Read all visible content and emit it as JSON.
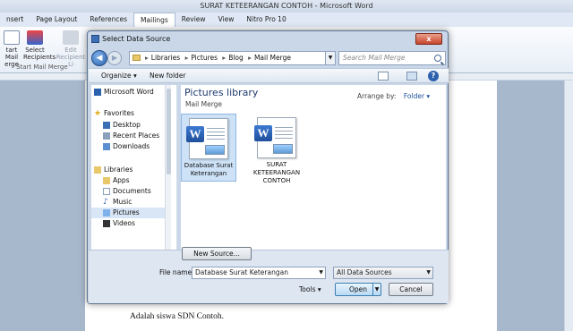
{
  "word": {
    "title": "SURAT KETEERANGAN CONTOH  -  Microsoft Word",
    "tabs": [
      "nsert",
      "Page Layout",
      "References",
      "Mailings",
      "Review",
      "View",
      "Nitro Pro 10"
    ],
    "active_tab": "Mailings",
    "ribbon": {
      "start_mail": "tart Mail\nerge",
      "select_recipients": "Select\nRecipients",
      "edit": "Edit\nRecipient Li",
      "group_label": "Start Mail Merge"
    },
    "body_text": "Adalah siswa SDN Contoh."
  },
  "dialog": {
    "title": "Select Data Source",
    "close": "x",
    "breadcrumb": [
      "Libraries",
      "Pictures",
      "Blog",
      "Mail Merge"
    ],
    "search_placeholder": "Search Mail Merge",
    "toolbar": {
      "organize": "Organize ▾",
      "new_folder": "New folder"
    },
    "nav": {
      "microsoft_word": "Microsoft Word",
      "favorites": "Favorites",
      "desktop": "Desktop",
      "recent_places": "Recent Places",
      "downloads": "Downloads",
      "libraries": "Libraries",
      "apps": "Apps",
      "documents": "Documents",
      "music": "Music",
      "pictures": "Pictures",
      "videos": "Videos"
    },
    "library": {
      "title": "Pictures library",
      "subtitle": "Mail Merge",
      "arrange_label": "Arrange by:",
      "arrange_value": "Folder ▾"
    },
    "files": [
      {
        "name": "Database Surat Keterangan",
        "selected": true
      },
      {
        "name": "SURAT KETEERANGAN CONTOH",
        "selected": false
      }
    ],
    "bottom": {
      "new_source": "New Source...",
      "file_name_label": "File name:",
      "file_name_value": "Database Surat Keterangan",
      "file_type": "All Data Sources",
      "tools": "Tools ▾",
      "open": "Open",
      "cancel": "Cancel"
    }
  }
}
